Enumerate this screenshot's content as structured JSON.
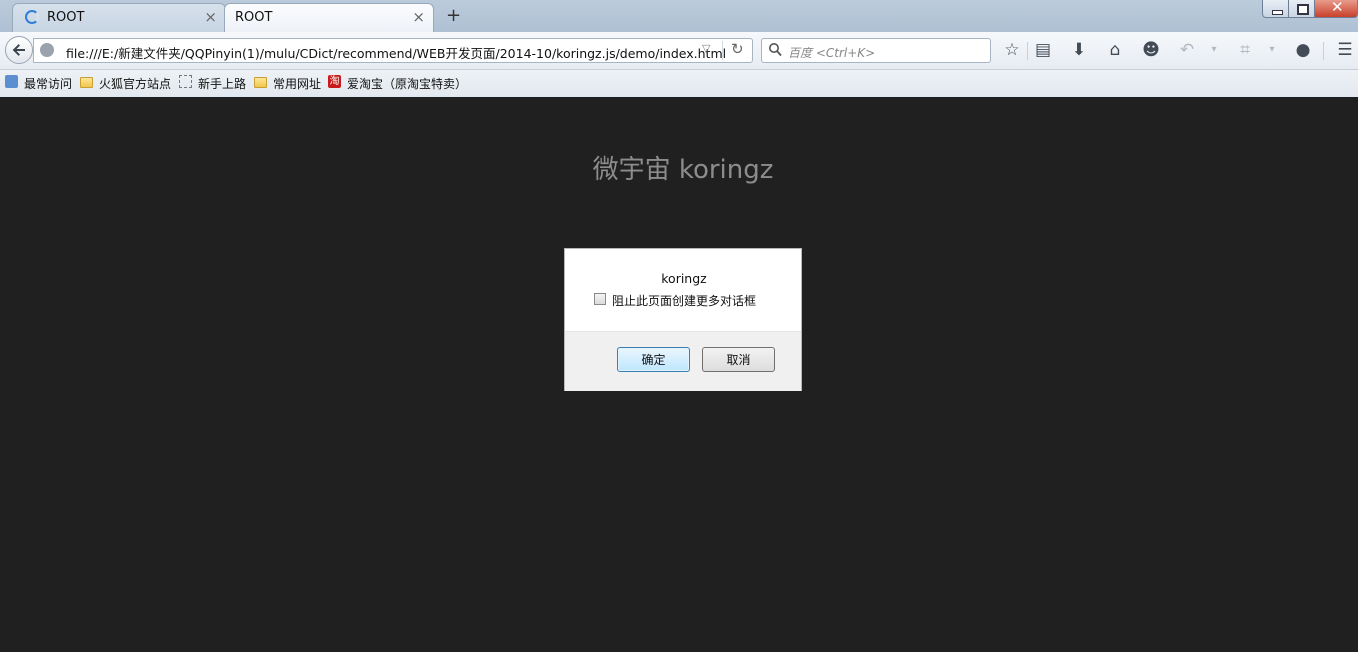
{
  "tabs": [
    {
      "label": "ROOT",
      "loading": true
    },
    {
      "label": "ROOT",
      "active": true
    }
  ],
  "new_tab_symbol": "+",
  "close_symbol": "×",
  "nav": {
    "url": "file:///E:/新建文件夹/QQPinyin(1)/mulu/CDict/recommend/WEB开发页面/2014-10/koringz.js/demo/index.html",
    "search_placeholder": "百度 <Ctrl+K>"
  },
  "bookmarks": [
    {
      "label": "最常访问",
      "icon": "most-visited-icon"
    },
    {
      "label": "火狐官方站点",
      "icon": "folder-icon"
    },
    {
      "label": "新手上路",
      "icon": "dashed-page-icon"
    },
    {
      "label": "常用网址",
      "icon": "folder-icon"
    },
    {
      "label": "爱淘宝（原淘宝特卖）",
      "icon": "taobao-icon",
      "icon_text": "淘"
    }
  ],
  "page": {
    "title": "微宇宙 koringz"
  },
  "dialog": {
    "message": "koringz",
    "checkbox_label": "阻止此页面创建更多对话框",
    "checkbox_checked": false,
    "ok_label": "确定",
    "cancel_label": "取消"
  },
  "colors": {
    "page_bg": "#202020",
    "title_text": "#8c8c8c",
    "chrome_bg": "#dfe6ee"
  }
}
